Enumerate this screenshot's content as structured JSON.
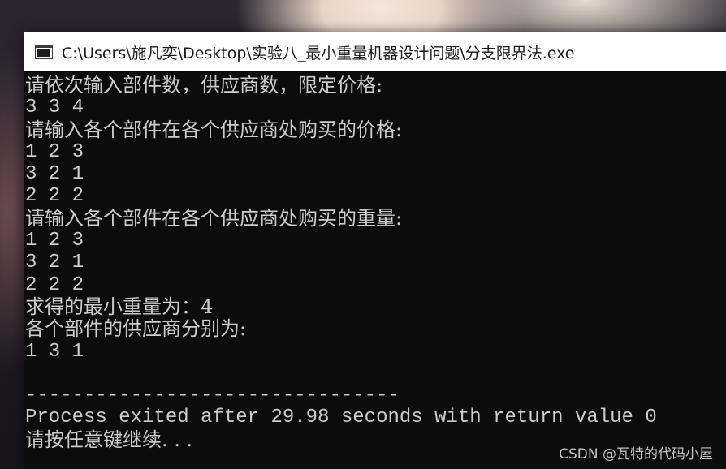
{
  "window": {
    "title": "C:\\Users\\施凡奕\\Desktop\\实验八_最小重量机器设计问题\\分支限界法.exe"
  },
  "console": {
    "lines": [
      "请依次输入部件数，供应商数，限定价格:",
      "3 3 4",
      "请输入各个部件在各个供应商处购买的价格:",
      "1 2 3",
      "3 2 1",
      "2 2 2",
      "请输入各个部件在各个供应商处购买的重量:",
      "1 2 3",
      "3 2 1",
      "2 2 2",
      "求得的最小重量为：4",
      "各个部件的供应商分别为:",
      "1 3 1",
      "",
      "--------------------------------",
      "Process exited after 29.98 seconds with return value 0",
      "请按任意键继续. . ."
    ]
  },
  "watermark": {
    "text": "CSDN @瓦特的代码小屋"
  },
  "colors": {
    "console_bg": "#0c0c0c",
    "console_fg": "#cccccc",
    "titlebar_bg": "#ffffff"
  },
  "icons": {
    "app": "console-window-icon"
  }
}
